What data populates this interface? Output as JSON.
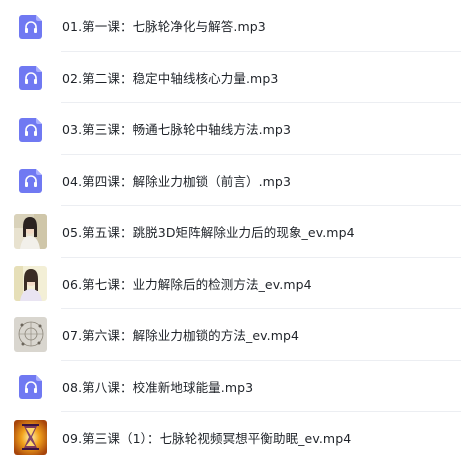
{
  "files": [
    {
      "name": "01.第一课：七脉轮净化与解答.mp3",
      "type": "audio",
      "icon": "headphones-file-icon"
    },
    {
      "name": "02.第二课：稳定中轴线核心力量.mp3",
      "type": "audio",
      "icon": "headphones-file-icon"
    },
    {
      "name": "03.第三课：畅通七脉轮中轴线方法.mp3",
      "type": "audio",
      "icon": "headphones-file-icon"
    },
    {
      "name": "04.第四课：解除业力枷锁（前言）.mp3",
      "type": "audio",
      "icon": "headphones-file-icon"
    },
    {
      "name": "05.第五课：跳脱3D矩阵解除业力后的现象_ev.mp4",
      "type": "video",
      "icon": "video-thumbnail-person"
    },
    {
      "name": "06.第七课：业力解除后的检测方法_ev.mp4",
      "type": "video",
      "icon": "video-thumbnail-person"
    },
    {
      "name": "07.第六课：解除业力枷锁的方法_ev.mp4",
      "type": "video",
      "icon": "video-thumbnail-diagram"
    },
    {
      "name": "08.第八课：校准新地球能量.mp3",
      "type": "audio",
      "icon": "headphones-file-icon"
    },
    {
      "name": "09.第三课（1）：七脉轮视频冥想平衡助眠_ev.mp4",
      "type": "video",
      "icon": "video-thumbnail-hourglass"
    }
  ],
  "colors": {
    "audio_icon": "#6b74f0",
    "text": "#1f2329",
    "divider": "#eceef2"
  }
}
